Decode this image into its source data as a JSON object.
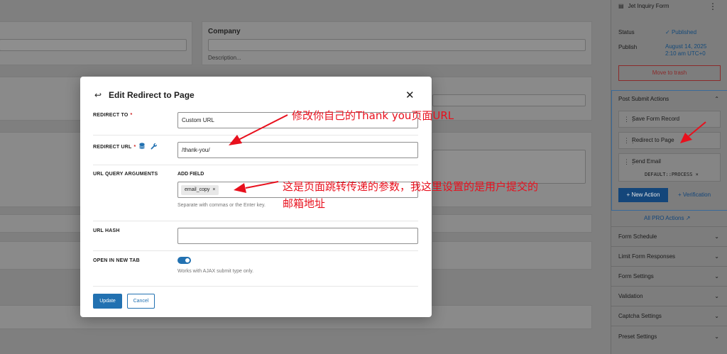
{
  "background": {
    "company_label": "Company",
    "company_description": "Description..."
  },
  "sidebar": {
    "form_title": "Jet Inquiry Form",
    "status_label": "Status",
    "status_value": "Published",
    "publish_label": "Publish",
    "publish_date": "August 14, 2025",
    "publish_time": "2:10 am UTC+0",
    "move_to_trash": "Move to trash",
    "post_submit_actions": "Post Submit Actions",
    "actions": [
      {
        "label": "Save Form Record"
      },
      {
        "label": "Redirect to Page"
      },
      {
        "label": "Send Email",
        "tag": "DEFAULT::PROCESS"
      }
    ],
    "new_action": "New Action",
    "verification": "Verification",
    "all_pro_actions": "All PRO Actions",
    "sections": [
      "Form Schedule",
      "Limit Form Responses",
      "Form Settings",
      "Validation",
      "Captcha Settings",
      "Preset Settings"
    ]
  },
  "modal": {
    "title": "Edit Redirect to Page",
    "redirect_to_label": "REDIRECT TO",
    "redirect_to_value": "Custom URL",
    "redirect_url_label": "REDIRECT URL",
    "redirect_url_value": "/thank-you/",
    "query_args_label": "URL QUERY ARGUMENTS",
    "add_field_label": "ADD FIELD",
    "chip_value": "email_copy",
    "query_help": "Separate with commas or the Enter key.",
    "url_hash_label": "URL HASH",
    "url_hash_value": "",
    "new_tab_label": "OPEN IN NEW TAB",
    "new_tab_enabled": true,
    "new_tab_help": "Works with AJAX submit type only.",
    "update_button": "Update",
    "cancel_button": "Cancel"
  },
  "annotations": {
    "note1": "修改你自己的Thank you页面URL",
    "note2_line1": "这是页面跳转传递的参数，我这里设置的是用户提交的",
    "note2_line2": "邮箱地址",
    "color": "#e8101d"
  }
}
